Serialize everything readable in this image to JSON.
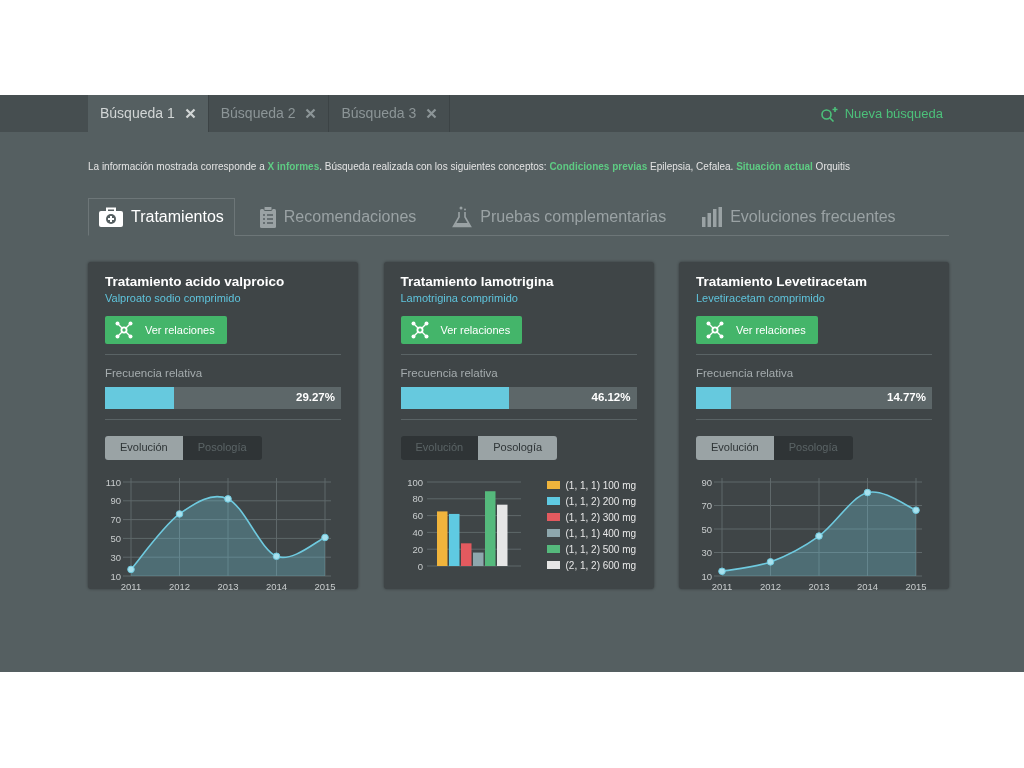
{
  "search_tabs": [
    {
      "label": "Búsqueda 1",
      "selected": true
    },
    {
      "label": "Búsqueda 2",
      "selected": false
    },
    {
      "label": "Búsqueda 3",
      "selected": false
    }
  ],
  "new_search": "Nueva búsqueda",
  "info": "La información mostrada corresponde a **X informes**. Búsqueda realizada con los siguientes conceptos: **Condiciones previas** Epilepsia, Cefalea. **Situación actual** Orquitis",
  "section_tabs": [
    {
      "label": "Tratamientos",
      "kind": "medkit",
      "selected": true
    },
    {
      "label": "Recomendaciones",
      "kind": "clipboard",
      "selected": false
    },
    {
      "label": "Pruebas complementarias",
      "kind": "flask",
      "selected": false
    },
    {
      "label": "Evoluciones frecuentes",
      "kind": "bars",
      "selected": false
    }
  ],
  "cards": [
    {
      "title": "Tratamiento acido valproico",
      "subtitle": "Valproato sodio comprimido",
      "button": "Ver relaciones",
      "freq_label": "Frecuencia relativa",
      "level": 0.2927,
      "reading": "29.27%",
      "toggles": [
        {
          "label": "Evolución",
          "selected": true
        },
        {
          "label": "Posología",
          "selected": false
        }
      ],
      "chart_data": {
        "type": "area",
        "categories": [
          "2011",
          "2012",
          "2013",
          "2014",
          "2015"
        ],
        "series": [
          {
            "color": "#6fcadf",
            "values": [
              17,
              76,
              92,
              31,
              51
            ]
          }
        ],
        "yticks": [
          10,
          30,
          50,
          70,
          90,
          110
        ],
        "ylim": [
          10,
          110
        ],
        "grid": true
      }
    },
    {
      "title": "Tratamiento lamotrigina",
      "subtitle": "Lamotrigina comprimido",
      "button": "Ver relaciones",
      "freq_label": "Frecuencia relativa",
      "level": 0.4612,
      "reading": "46.12%",
      "toggles": [
        {
          "label": "Evolución",
          "selected": false
        },
        {
          "label": "Posología",
          "selected": true
        }
      ],
      "chart_data": {
        "type": "bar",
        "series": [
          {
            "name": "(1, 1, 1) 100 mg",
            "color": "#f0b43c",
            "values": [
              65
            ]
          },
          {
            "name": "(1, 1, 2) 200 mg",
            "color": "#5fcae2",
            "values": [
              62
            ]
          },
          {
            "name": "(1, 1, 2) 300 mg",
            "color": "#e35a5f",
            "values": [
              27
            ]
          },
          {
            "name": "(1, 1, 1) 400 mg",
            "color": "#8ea7ad",
            "values": [
              16
            ]
          },
          {
            "name": "(1, 1, 2) 500 mg",
            "color": "#55b97c",
            "values": [
              89
            ]
          },
          {
            "name": "(2, 1, 2) 600 mg",
            "color": "#e6e6e6",
            "values": [
              73
            ]
          }
        ],
        "yticks": [
          0,
          20,
          40,
          60,
          80,
          100
        ],
        "ylim": [
          0,
          100
        ],
        "grid": true,
        "legend": "right"
      }
    },
    {
      "title": "Tratamiento Levetiracetam",
      "subtitle": "Levetiracetam comprimido",
      "button": "Ver relaciones",
      "freq_label": "Frecuencia relativa",
      "level": 0.1477,
      "reading": "14.77%",
      "toggles": [
        {
          "label": "Evolución",
          "selected": true
        },
        {
          "label": "Posología",
          "selected": false
        }
      ],
      "chart_data": {
        "type": "area",
        "categories": [
          "2011",
          "2012",
          "2013",
          "2014",
          "2015"
        ],
        "series": [
          {
            "color": "#6fcadf",
            "values": [
              14,
              22,
              44,
              81,
              66
            ]
          }
        ],
        "yticks": [
          10,
          30,
          50,
          70,
          90
        ],
        "ylim": [
          10,
          90
        ],
        "grid": true
      }
    }
  ]
}
